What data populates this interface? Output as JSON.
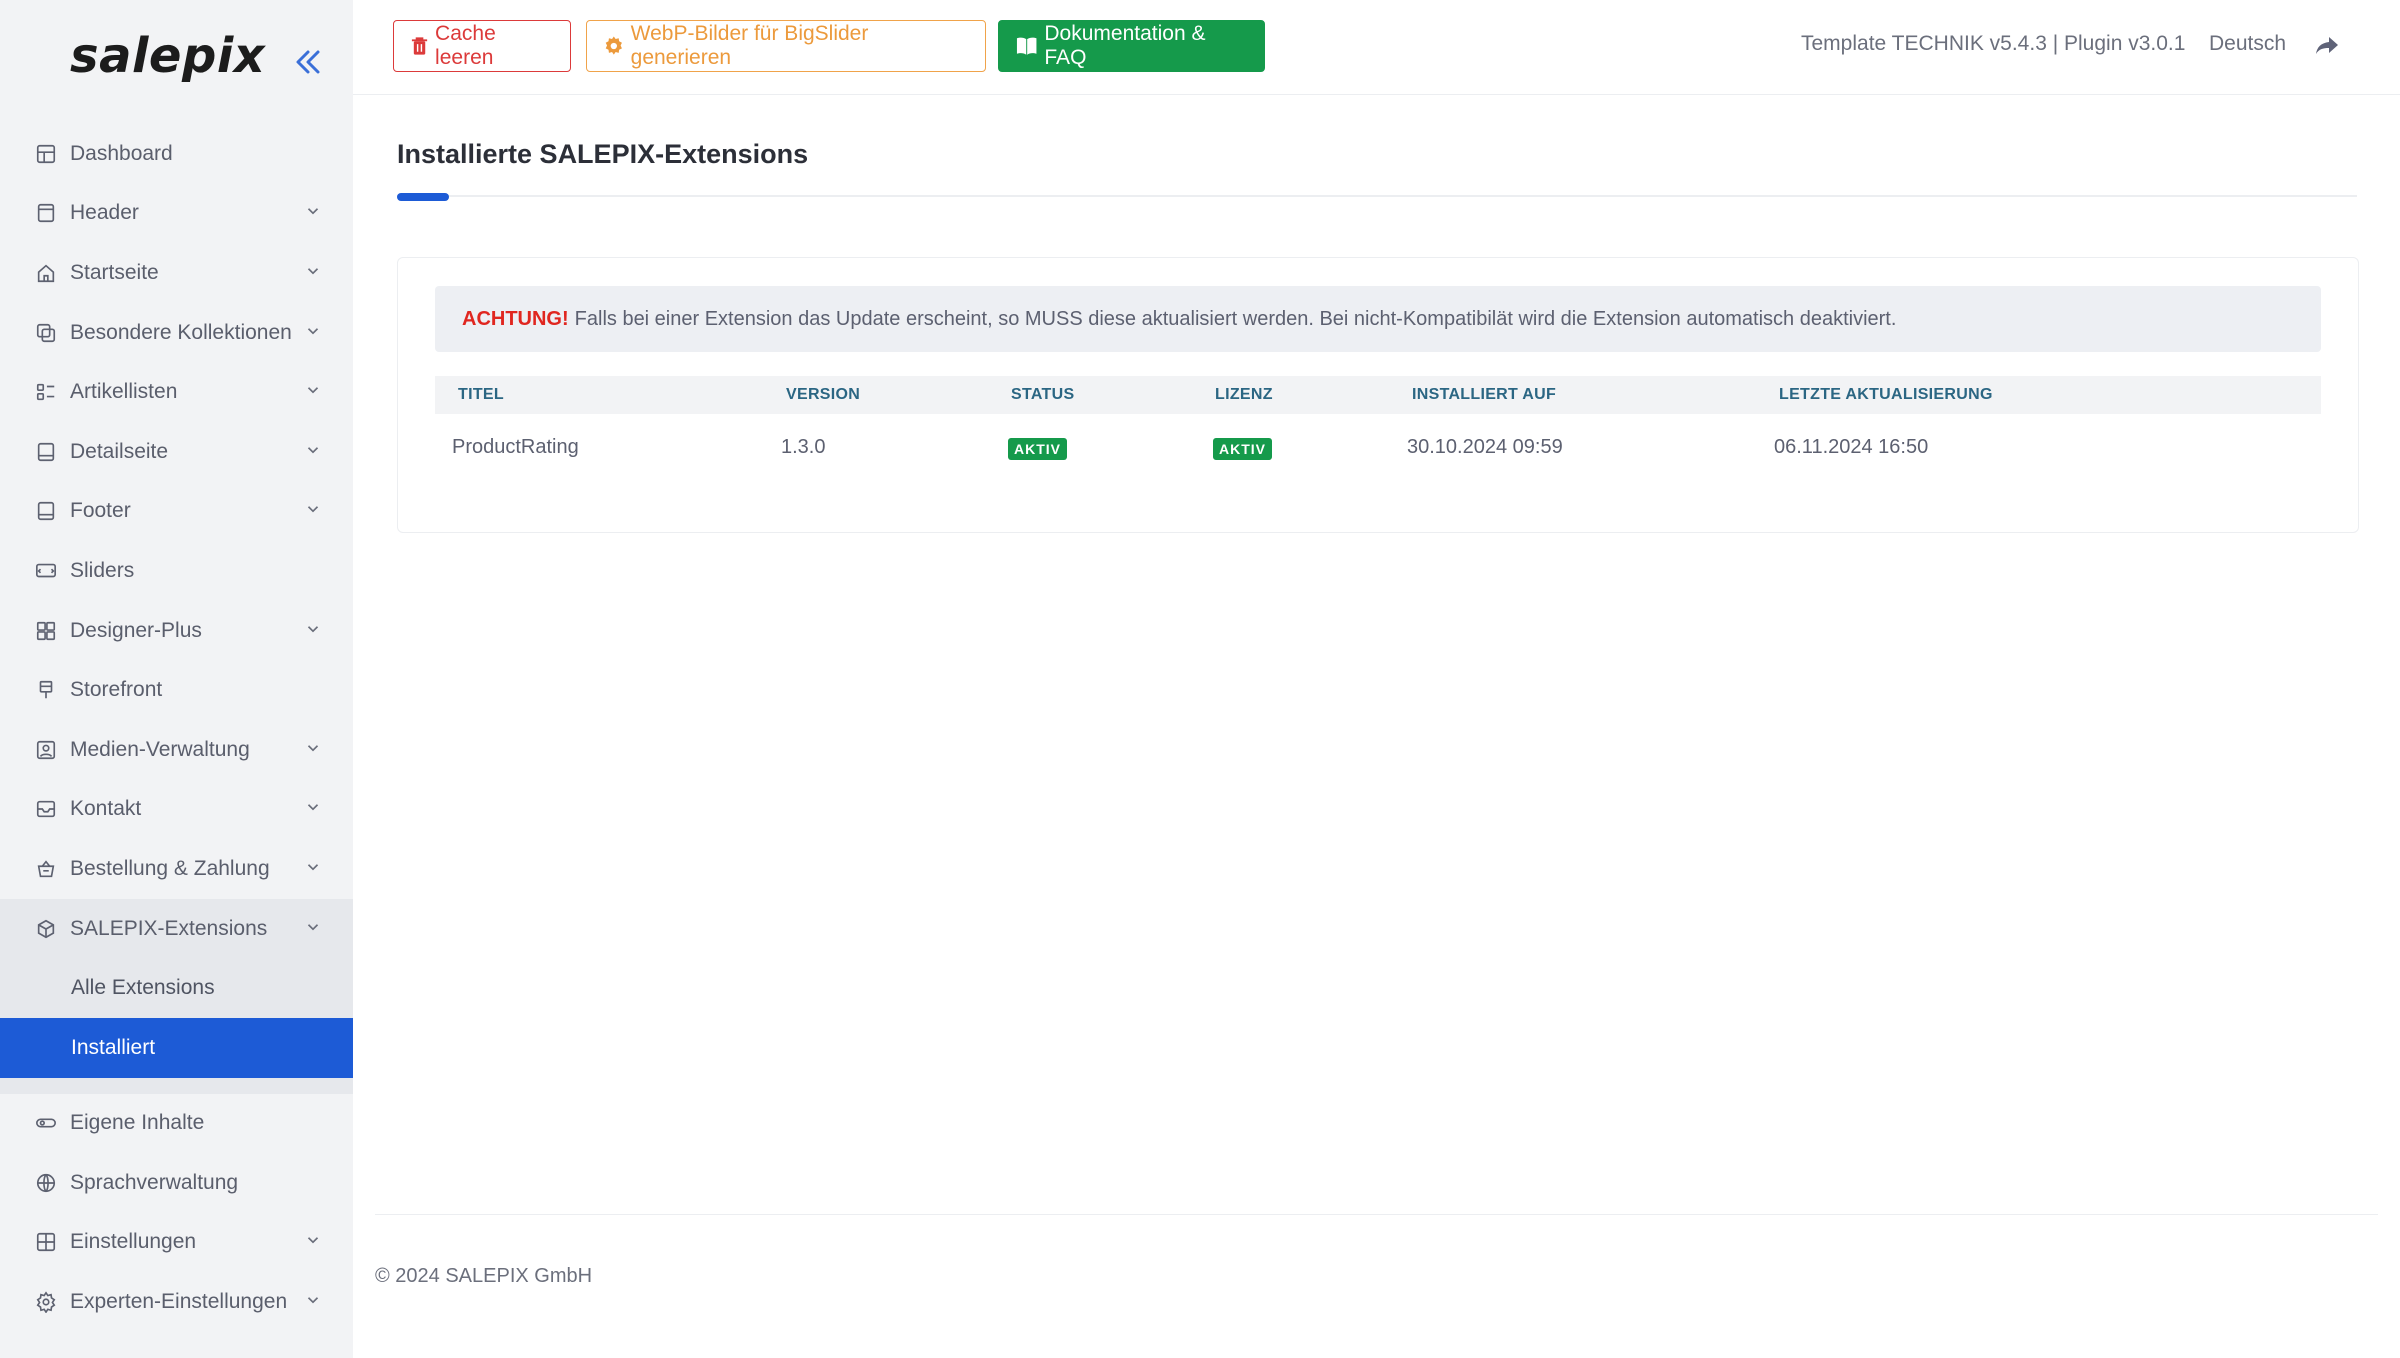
{
  "brand": {
    "logo_text": "salepix",
    "accent": "#1d5bd6"
  },
  "sidebar": {
    "items": [
      {
        "label": "Dashboard",
        "icon": "dashboard-icon",
        "has_children": false
      },
      {
        "label": "Header",
        "icon": "header-icon",
        "has_children": true
      },
      {
        "label": "Startseite",
        "icon": "home-icon",
        "has_children": true
      },
      {
        "label": "Besondere Kollektionen",
        "icon": "collections-icon",
        "has_children": true
      },
      {
        "label": "Artikellisten",
        "icon": "list-icon",
        "has_children": true
      },
      {
        "label": "Detailseite",
        "icon": "detail-page-icon",
        "has_children": true
      },
      {
        "label": "Footer",
        "icon": "footer-icon",
        "has_children": true
      },
      {
        "label": "Sliders",
        "icon": "slider-icon",
        "has_children": false
      },
      {
        "label": "Designer-Plus",
        "icon": "designer-icon",
        "has_children": true
      },
      {
        "label": "Storefront",
        "icon": "storefront-icon",
        "has_children": false
      },
      {
        "label": "Medien-Verwaltung",
        "icon": "media-icon",
        "has_children": true
      },
      {
        "label": "Kontakt",
        "icon": "mail-icon",
        "has_children": true
      },
      {
        "label": "Bestellung & Zahlung",
        "icon": "basket-icon",
        "has_children": true
      },
      {
        "label": "SALEPIX-Extensions",
        "icon": "package-icon",
        "has_children": true,
        "open": true
      }
    ],
    "submenu": [
      {
        "label": "Alle Extensions",
        "active": false
      },
      {
        "label": "Installiert",
        "active": true
      }
    ],
    "items_after": [
      {
        "label": "Eigene Inhalte",
        "icon": "toggle-icon",
        "has_children": false
      },
      {
        "label": "Sprachverwaltung",
        "icon": "globe-icon",
        "has_children": false
      },
      {
        "label": "Einstellungen",
        "icon": "grid-icon",
        "has_children": true
      },
      {
        "label": "Experten-Einstellungen",
        "icon": "gear-icon",
        "has_children": true
      }
    ]
  },
  "topbar": {
    "cache_label": "Cache leeren",
    "webp_label": "WebP-Bilder für BigSlider generieren",
    "docs_label": "Dokumentation & FAQ",
    "version_text": "Template TECHNIK v5.4.3 | Plugin v3.0.1",
    "language": "Deutsch"
  },
  "main": {
    "title": "Installierte SALEPIX-Extensions",
    "alert": {
      "prefix": "ACHTUNG!",
      "text": "Falls bei einer Extension das Update erscheint, so MUSS diese aktualisiert werden. Bei nicht-Kompatibilät wird die Extension automatisch deaktiviert."
    },
    "table": {
      "headers": [
        "TITEL",
        "VERSION",
        "STATUS",
        "LIZENZ",
        "INSTALLIERT AUF",
        "LETZTE AKTUALISIERUNG"
      ],
      "rows": [
        {
          "title": "ProductRating",
          "version": "1.3.0",
          "status": "AKTIV",
          "license": "AKTIV",
          "installed": "30.10.2024 09:59",
          "updated": "06.11.2024 16:50"
        }
      ]
    }
  },
  "footer": {
    "text": "© 2024 SALEPIX GmbH"
  }
}
